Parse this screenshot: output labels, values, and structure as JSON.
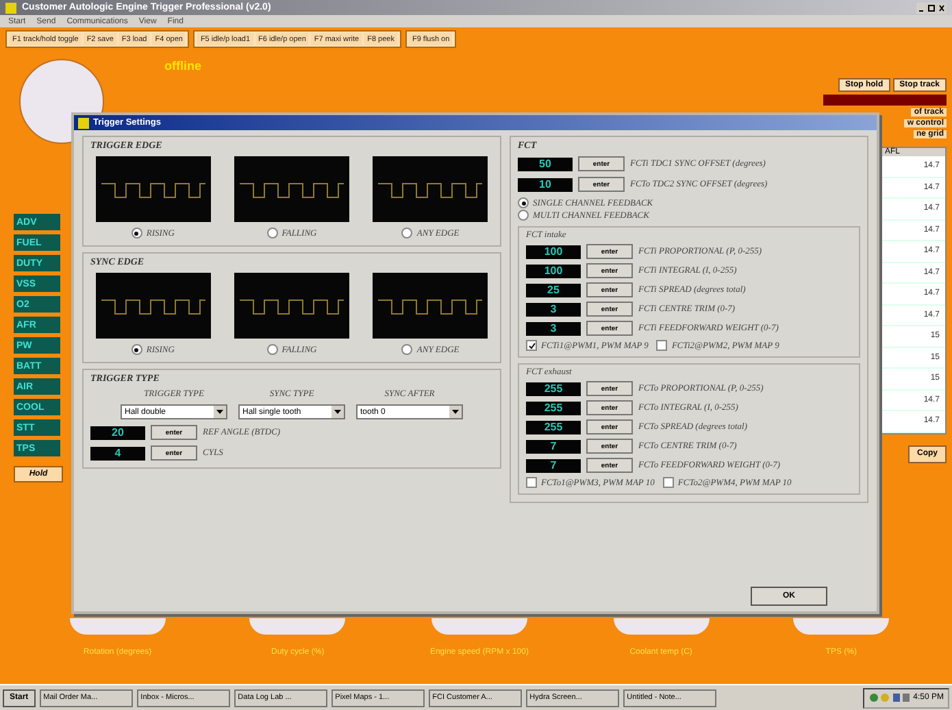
{
  "window": {
    "title": "Customer Autologic Engine Trigger Professional (v2.0)"
  },
  "menu": [
    "Start",
    "Send",
    "Communications",
    "View",
    "Find"
  ],
  "toolbar": [
    [
      "F1 track/hold toggle",
      "F2 save",
      "F3 load",
      "F4 open"
    ],
    [
      "F5 idle/p load1",
      "F6 idle/p open",
      "F7 maxi write",
      "F8 peek"
    ],
    [
      "F9 flush on"
    ]
  ],
  "status": "offline",
  "channels": [
    "ADV",
    "FUEL",
    "DUTY",
    "VSS",
    "O2",
    "AFR",
    "PW",
    "BATT",
    "AIR",
    "COOL",
    "STT",
    "TPS"
  ],
  "hold_button": "Hold",
  "right_panel": {
    "buttons": [
      "Stop hold",
      "Stop track"
    ],
    "links": [
      "of track",
      "w control",
      "ne grid"
    ],
    "column": "AFL",
    "values": [
      "14.7",
      "14.7",
      "14.7",
      "14.7",
      "14.7",
      "14.7",
      "14.7",
      "14.7",
      "15",
      "15",
      "15",
      "14.7",
      "14.7"
    ],
    "copy_button": "Copy"
  },
  "gauges": [
    "Rotation (degrees)",
    "Duty cycle (%)",
    "Engine speed (RPM x 100)",
    "Coolant temp (C)",
    "TPS (%)"
  ],
  "dialog": {
    "title": "Trigger Settings",
    "trigger_edge": {
      "title": "TRIGGER EDGE",
      "options": [
        {
          "label": "RISING",
          "selected": true
        },
        {
          "label": "FALLING",
          "selected": false
        },
        {
          "label": "ANY EDGE",
          "selected": false
        }
      ]
    },
    "sync_edge": {
      "title": "SYNC EDGE",
      "options": [
        {
          "label": "RISING",
          "selected": true
        },
        {
          "label": "FALLING",
          "selected": false
        },
        {
          "label": "ANY EDGE",
          "selected": false
        }
      ]
    },
    "trigger_type": {
      "title": "TRIGGER TYPE",
      "selects": [
        {
          "label": "TRIGGER TYPE",
          "value": "Hall double"
        },
        {
          "label": "SYNC TYPE",
          "value": "Hall single tooth"
        },
        {
          "label": "SYNC AFTER",
          "value": "tooth 0"
        }
      ],
      "entries": [
        {
          "value": "20",
          "button": "enter",
          "label": "REF ANGLE (BTDC)"
        },
        {
          "value": "4",
          "button": "enter",
          "label": "CYLS"
        }
      ]
    },
    "fct": {
      "title": "FCT",
      "offsets": [
        {
          "value": "50",
          "button": "enter",
          "label": "FCTi TDC1 SYNC OFFSET (degrees)"
        },
        {
          "value": "10",
          "button": "enter",
          "label": "FCTo TDC2 SYNC OFFSET (degrees)"
        }
      ],
      "feedback": [
        {
          "label": "SINGLE CHANNEL FEEDBACK",
          "selected": true
        },
        {
          "label": "MULTI CHANNEL FEEDBACK",
          "selected": false
        }
      ],
      "groups": [
        {
          "title": "FCT intake",
          "rows": [
            {
              "value": "100",
              "button": "enter",
              "label": "FCTi PROPORTIONAL (P, 0-255)"
            },
            {
              "value": "100",
              "button": "enter",
              "label": "FCTi INTEGRAL (I, 0-255)"
            },
            {
              "value": "25",
              "button": "enter",
              "label": "FCTi SPREAD (degrees total)"
            },
            {
              "value": "3",
              "button": "enter",
              "label": "FCTi CENTRE TRIM (0-7)"
            },
            {
              "value": "3",
              "button": "enter",
              "label": "FCTi FEEDFORWARD WEIGHT (0-7)"
            }
          ],
          "checks": [
            {
              "label": "FCTi1@PWM1, PWM MAP 9",
              "checked": true
            },
            {
              "label": "FCTi2@PWM2, PWM MAP 9",
              "checked": false
            }
          ]
        },
        {
          "title": "FCT exhaust",
          "rows": [
            {
              "value": "255",
              "button": "enter",
              "label": "FCTo PROPORTIONAL (P, 0-255)"
            },
            {
              "value": "255",
              "button": "enter",
              "label": "FCTo INTEGRAL (I, 0-255)"
            },
            {
              "value": "255",
              "button": "enter",
              "label": "FCTo SPREAD (degrees total)"
            },
            {
              "value": "7",
              "button": "enter",
              "label": "FCTo CENTRE TRIM (0-7)"
            },
            {
              "value": "7",
              "button": "enter",
              "label": "FCTo FEEDFORWARD WEIGHT (0-7)"
            }
          ],
          "checks": [
            {
              "label": "FCTo1@PWM3, PWM MAP 10",
              "checked": false
            },
            {
              "label": "FCTo2@PWM4, PWM MAP 10",
              "checked": false
            }
          ]
        }
      ]
    },
    "ok_button": "OK"
  },
  "taskbar": {
    "start": "Start",
    "tasks": [
      "Mail Order Ma...",
      "Inbox - Micros...",
      "Data Log Lab ...",
      "Pixel Maps - 1...",
      "FCI Customer A...",
      "Hydra Screen...",
      "Untitled - Note..."
    ],
    "clock": "4:50 PM"
  }
}
